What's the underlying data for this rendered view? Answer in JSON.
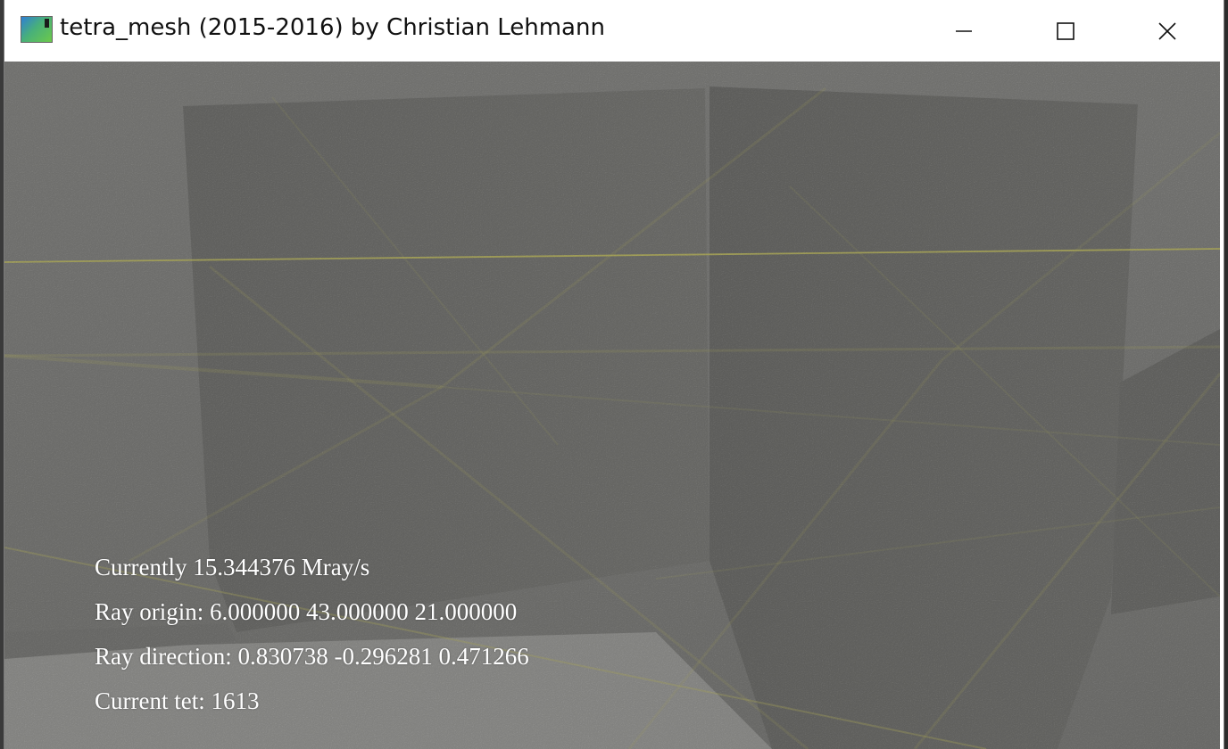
{
  "window": {
    "title": "tetra_mesh (2015-2016) by Christian Lehmann",
    "icon": "app-icon",
    "controls": {
      "minimize": "minimize-icon",
      "maximize": "maximize-icon",
      "close": "close-icon"
    }
  },
  "hud": {
    "rate": "Currently 15.344376 Mray/s",
    "origin": "Ray origin: 6.000000 43.000000 21.000000",
    "direction": "Ray direction: 0.830738 -0.296281 0.471266",
    "tet": "Current tet: 1613"
  },
  "colors": {
    "mesh_line": "#c8c23a",
    "floor": "#7a7a76",
    "box": "#565651",
    "hud_text": "#ffffff"
  }
}
